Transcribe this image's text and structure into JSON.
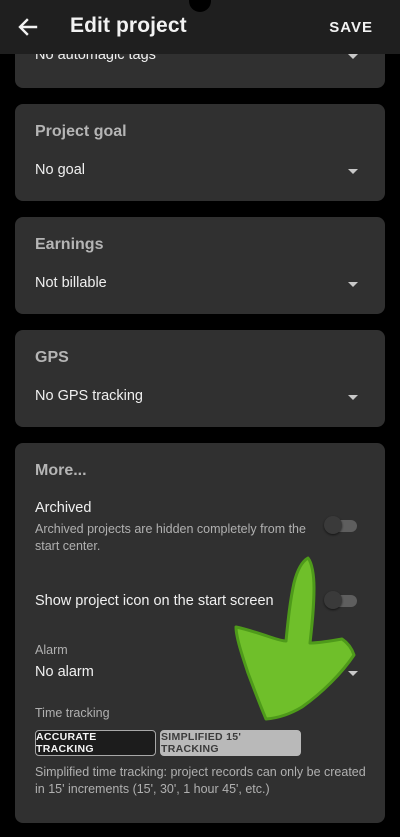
{
  "appbar": {
    "title": "Edit project",
    "save_label": "SAVE",
    "back_icon": "arrow-left-icon"
  },
  "tags_card": {
    "value": "No automagic tags"
  },
  "goal_card": {
    "title": "Project goal",
    "value": "No goal"
  },
  "earnings_card": {
    "title": "Earnings",
    "value": "Not billable"
  },
  "gps_card": {
    "title": "GPS",
    "value": "No GPS tracking"
  },
  "more_card": {
    "title": "More...",
    "archived": {
      "label": "Archived",
      "description": "Archived projects are hidden completely from the start center.",
      "enabled": false
    },
    "show_icon": {
      "label": "Show project icon on the start screen",
      "enabled": false
    },
    "alarm": {
      "caption": "Alarm",
      "value": "No alarm"
    },
    "time_tracking": {
      "caption": "Time tracking",
      "options": [
        "ACCURATE TRACKING",
        "SIMPLIFIED 15' TRACKING"
      ],
      "selected": "ACCURATE TRACKING",
      "description": "Simplified time tracking: project records can only be created in 15' increments (15', 30', 1 hour 45', etc.)"
    }
  },
  "colors": {
    "background": "#000000",
    "appbar": "#1f1f1f",
    "card": "#303030",
    "arrow_overlay": "#6fbf2a"
  }
}
